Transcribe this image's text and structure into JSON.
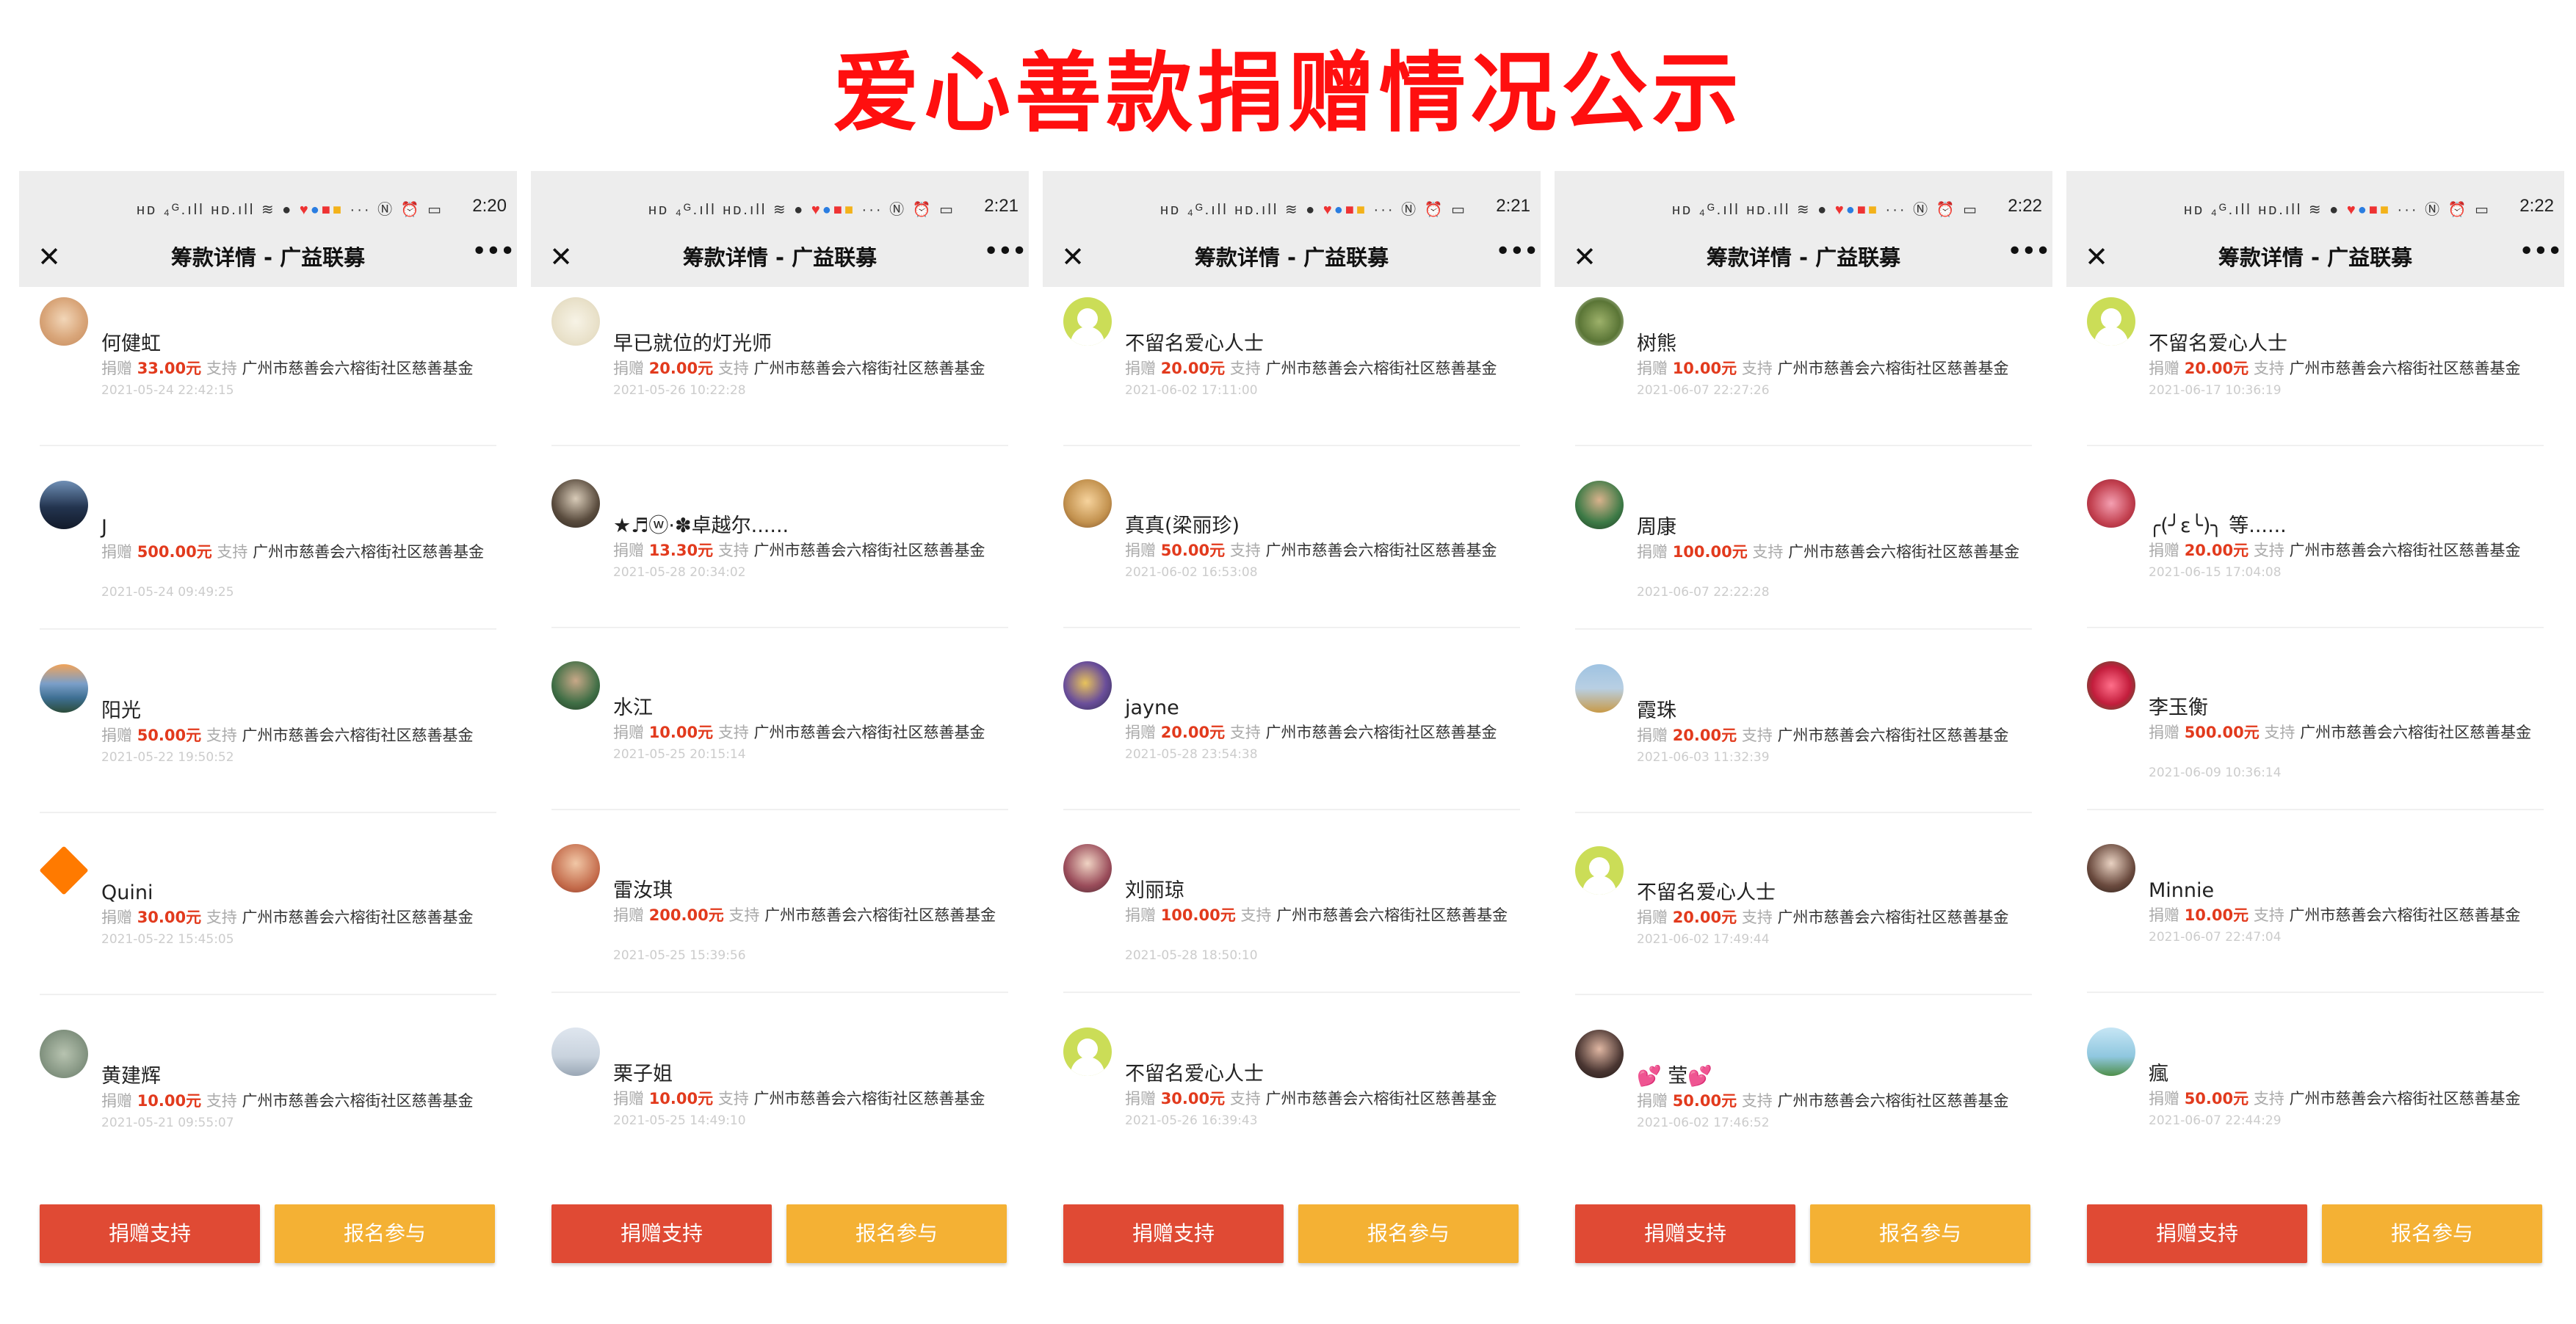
{
  "title": "爱心善款捐赠情况公示",
  "nav_title": "筹款详情 - 广益联募",
  "label_donate": "捐赠",
  "label_support": "支持",
  "org": "广州市慈善会六榕街社区慈善基金",
  "buttons": {
    "donate": "捐赠支持",
    "join": "报名参与"
  },
  "colors": {
    "title": "#ff0f0f",
    "amount": "#e23a1d",
    "donate_button": "#e04a34",
    "join_button": "#f4b134"
  },
  "icons": {
    "close": "close-icon",
    "more": "more-icon"
  },
  "panels": [
    {
      "time": "2:20",
      "items": [
        {
          "name": "何健虹",
          "amount": "33.00元",
          "date": "2021-05-24 22:42:15"
        },
        {
          "name": "J",
          "amount": "500.00元",
          "date": "2021-05-24 09:49:25"
        },
        {
          "name": "阳光",
          "amount": "50.00元",
          "date": "2021-05-22 19:50:52"
        },
        {
          "name": "Quini",
          "amount": "30.00元",
          "date": "2021-05-22 15:45:05"
        },
        {
          "name": "黄建辉",
          "amount": "10.00元",
          "date": "2021-05-21 09:55:07"
        }
      ]
    },
    {
      "time": "2:21",
      "items": [
        {
          "name": "早已就位的灯光师",
          "amount": "20.00元",
          "date": "2021-05-26 10:22:28"
        },
        {
          "name": "★♬ⓦ·✽卓越尔......",
          "amount": "13.30元",
          "date": "2021-05-28 20:34:02"
        },
        {
          "name": "水江",
          "amount": "10.00元",
          "date": "2021-05-25 20:15:14"
        },
        {
          "name": "雷汝琪",
          "amount": "200.00元",
          "date": "2021-05-25 15:39:56"
        },
        {
          "name": "栗子姐",
          "amount": "10.00元",
          "date": "2021-05-25 14:49:10"
        }
      ]
    },
    {
      "time": "2:21",
      "items": [
        {
          "name": "不留名爱心人士",
          "amount": "20.00元",
          "date": "2021-06-02 17:11:00"
        },
        {
          "name": "真真(梁丽珍)",
          "amount": "50.00元",
          "date": "2021-06-02 16:53:08"
        },
        {
          "name": "jayne",
          "amount": "20.00元",
          "date": "2021-05-28 23:54:38"
        },
        {
          "name": "刘丽琼",
          "amount": "100.00元",
          "date": "2021-05-28 18:50:10"
        },
        {
          "name": "不留名爱心人士",
          "amount": "30.00元",
          "date": "2021-05-26 16:39:43"
        }
      ]
    },
    {
      "time": "2:22",
      "items": [
        {
          "name": "树熊",
          "amount": "10.00元",
          "date": "2021-06-07 22:27:26"
        },
        {
          "name": "周康",
          "amount": "100.00元",
          "date": "2021-06-07 22:22:28"
        },
        {
          "name": "霞珠",
          "amount": "20.00元",
          "date": "2021-06-03 11:32:39"
        },
        {
          "name": "不留名爱心人士",
          "amount": "20.00元",
          "date": "2021-06-02 17:49:44"
        },
        {
          "name": "💕 莹💕",
          "amount": "50.00元",
          "date": "2021-06-02 17:46:52"
        }
      ]
    },
    {
      "time": "2:22",
      "items": [
        {
          "name": "不留名爱心人士",
          "amount": "20.00元",
          "date": "2021-06-17 10:36:19"
        },
        {
          "name": "╭(╯ε╰)╮ 等......",
          "amount": "20.00元",
          "date": "2021-06-15 17:04:08"
        },
        {
          "name": "李玉衡",
          "amount": "500.00元",
          "date": "2021-06-09 10:36:14"
        },
        {
          "name": "Minnie",
          "amount": "10.00元",
          "date": "2021-06-07 22:47:04"
        },
        {
          "name": "瘋",
          "amount": "50.00元",
          "date": "2021-06-07 22:44:29"
        }
      ]
    }
  ]
}
